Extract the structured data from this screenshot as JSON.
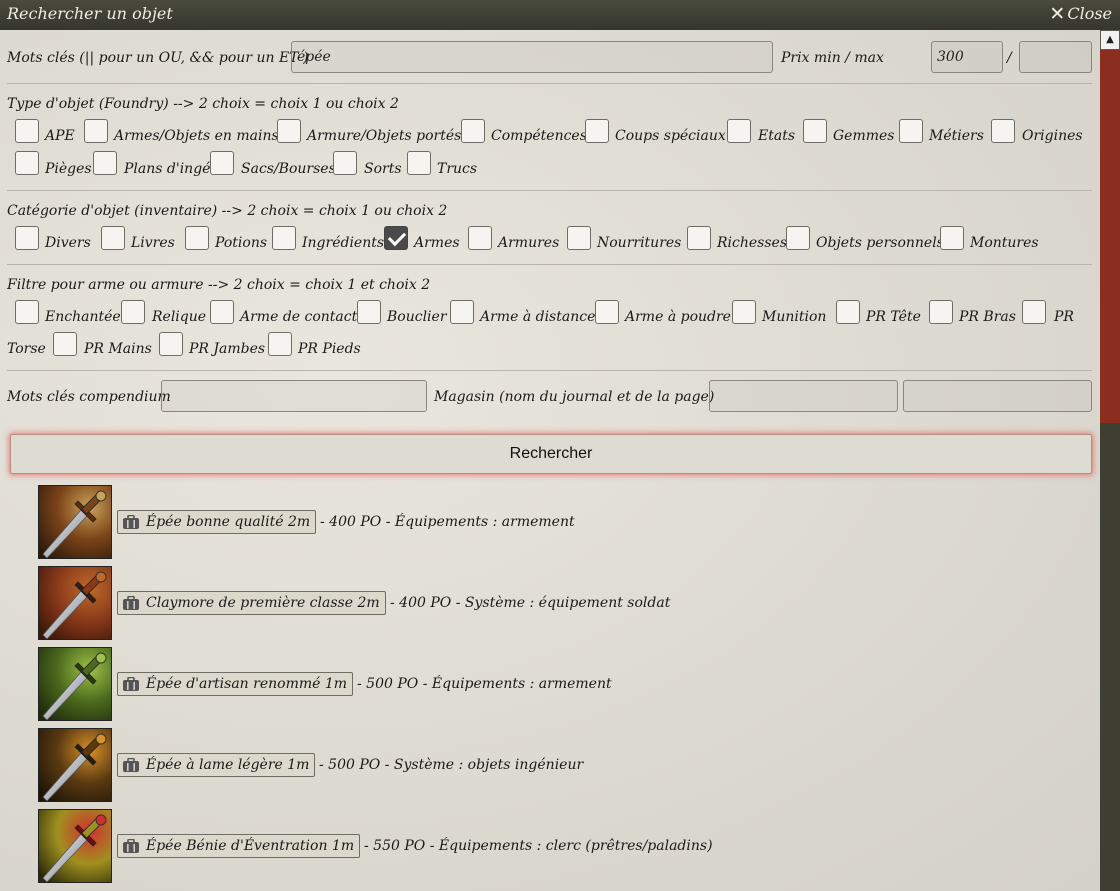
{
  "window": {
    "title": "Rechercher un objet",
    "close_label": "Close"
  },
  "search": {
    "keywords_label": "Mots clés (|| pour un OU, && pour un ET )",
    "keywords_value": "épée",
    "price_label": "Prix min / max",
    "price_min": "300",
    "price_max": "",
    "price_sep": "/"
  },
  "type_section": {
    "label": "Type d'objet (Foundry) --> 2 choix = choix 1 ou choix 2",
    "options": [
      "APE",
      "Armes/Objets en mains",
      "Armure/Objets portés",
      "Compétences",
      "Coups spéciaux",
      "Etats",
      "Gemmes",
      "Métiers",
      "Origines",
      "Pièges",
      "Plans d'ingé",
      "Sacs/Bourses",
      "Sorts",
      "Trucs"
    ]
  },
  "category_section": {
    "label": "Catégorie d'objet (inventaire) --> 2 choix = choix 1 ou choix 2",
    "options": [
      "Divers",
      "Livres",
      "Potions",
      "Ingrédients",
      "Armes",
      "Armures",
      "Nourritures",
      "Richesses",
      "Objets personnels",
      "Montures"
    ],
    "checked": "Armes"
  },
  "filter_section": {
    "label": "Filtre pour arme ou armure --> 2 choix = choix 1 et choix 2",
    "options": [
      "Enchantée",
      "Relique",
      "Arme de contact",
      "Bouclier",
      "Arme à distance",
      "Arme à poudre",
      "Munition",
      "PR Tête",
      "PR Bras",
      "PR Torse",
      "PR Mains",
      "PR Jambes",
      "PR Pieds"
    ]
  },
  "compendium": {
    "label": "Mots clés compendium",
    "value": ""
  },
  "shop": {
    "label": "Magasin (nom du journal et de la page)",
    "journal": "",
    "page": ""
  },
  "search_button": "Rechercher",
  "results": [
    {
      "name": "Épée bonne qualité 2m",
      "rest": "- 400 PO - Équipements : armement",
      "icon": "sword-icon"
    },
    {
      "name": "Claymore de première classe 2m",
      "rest": "- 400 PO - Système : équipement soldat",
      "icon": "sword-icon"
    },
    {
      "name": "Épée d'artisan renommé 1m",
      "rest": "- 500 PO - Équipements : armement",
      "icon": "sword-icon"
    },
    {
      "name": "Épée à lame légère 1m",
      "rest": "- 500 PO - Système : objets ingénieur",
      "icon": "sword-icon"
    },
    {
      "name": "Épée Bénie d'Éventration 1m",
      "rest": "- 550 PO - Équipements : clerc (prêtres/paladins)",
      "icon": "sword-icon"
    }
  ],
  "colors": {
    "accent": "#8b2d1f",
    "panel": "#dcd9d0",
    "titlebar": "#3e3f33"
  }
}
